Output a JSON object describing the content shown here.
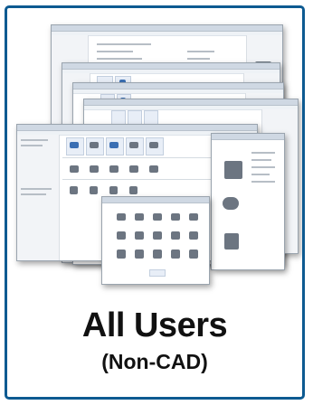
{
  "heading": "All Users",
  "subheading": "(Non-CAD)",
  "colors": {
    "frame": "#0d5a91",
    "accent": "#3b6fb3",
    "text": "#111111"
  },
  "collage": {
    "description_icon": "stacked-application-windows"
  }
}
